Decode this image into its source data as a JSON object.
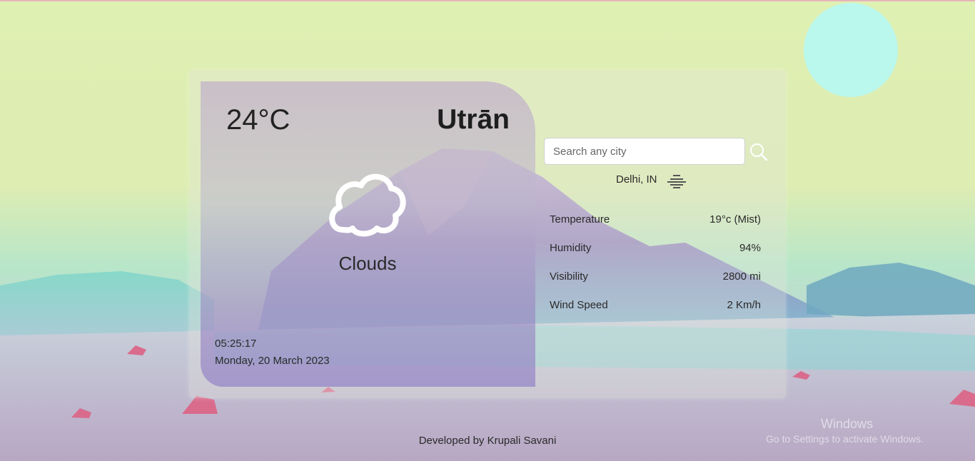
{
  "weather": {
    "temperature": "24°C",
    "city": "Utrān",
    "condition": "Clouds",
    "time": "05:25:17",
    "date": "Monday, 20 March 2023",
    "icon": "cloud-outline-icon"
  },
  "search": {
    "placeholder": "Search any city",
    "value": "",
    "button_icon": "search-icon"
  },
  "current": {
    "location": "Delhi, IN",
    "icon": "mist-icon"
  },
  "details": [
    {
      "label": "Temperature",
      "value": "19°c (Mist)"
    },
    {
      "label": "Humidity",
      "value": "94%"
    },
    {
      "label": "Visibility",
      "value": "2800 mi"
    },
    {
      "label": "Wind Speed",
      "value": "2 Km/h"
    }
  ],
  "footer": "Developed by Krupali Savani",
  "watermark": {
    "line1": "Windows",
    "line2": "Go to Settings to activate Windows."
  },
  "colors": {
    "sky": "#dff0b3",
    "sun": "#baf7ec",
    "mountain": "#9c84c4",
    "water": "#6cd2cf"
  }
}
